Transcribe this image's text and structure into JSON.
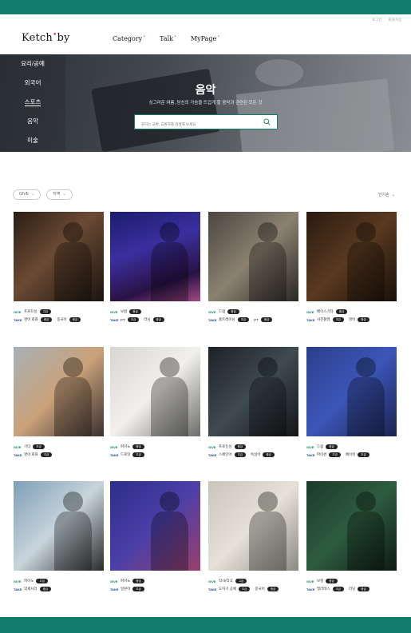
{
  "util": {
    "login": "로그인",
    "join": "회원가입"
  },
  "logo": {
    "text1": "Ketch",
    "dot": "•",
    "text2": "by"
  },
  "nav": [
    {
      "label": "Category",
      "mark": "•"
    },
    {
      "label": "Talk",
      "mark": "•"
    },
    {
      "label": "MyPage",
      "mark": "•"
    }
  ],
  "sidebar": {
    "items": [
      "요리/공예",
      "외국어",
      "스포츠",
      "음악",
      "미술"
    ],
    "active_index": 2
  },
  "hero": {
    "title": "음악",
    "subtitle": "싱그러운 여름, 당신의 가슴을 뜨겁게 할 음악과 관련된 모든 것",
    "search_placeholder": "원하는 교환, 교환자를 검색해 보세요"
  },
  "filters": [
    {
      "label": "GIVE",
      "chev": "⌄"
    },
    {
      "label": "지역",
      "chev": "⌄"
    }
  ],
  "sort": {
    "label": "인기순",
    "chev": "⌄"
  },
  "cards": [
    {
      "give": "프로듀싱",
      "give_lv": "고급",
      "take": [
        {
          "v": "영어 회화",
          "lv": "중급"
        },
        {
          "v": "중국어",
          "lv": "중급"
        }
      ]
    },
    {
      "give": "보컬",
      "give_lv": "중급",
      "take": [
        {
          "v": "PT",
          "lv": "초급"
        },
        {
          "v": "러닝",
          "lv": "중급"
        }
      ]
    },
    {
      "give": "드럼",
      "give_lv": "중급",
      "take": [
        {
          "v": "홈트레이닝",
          "lv": "초급"
        },
        {
          "v": "PT",
          "lv": "중급"
        }
      ]
    },
    {
      "give": "베이스기타",
      "give_lv": "중급",
      "take": [
        {
          "v": "사진촬영",
          "lv": "초급"
        },
        {
          "v": "영어",
          "lv": "중급"
        }
      ]
    },
    {
      "give": "기타",
      "give_lv": "초급",
      "take": [
        {
          "v": "영어 회화",
          "lv": "초급"
        }
      ]
    },
    {
      "give": "피아노",
      "give_lv": "중급",
      "take": [
        {
          "v": "드로잉",
          "lv": "초급"
        }
      ]
    },
    {
      "give": "프로듀싱",
      "give_lv": "중급",
      "take": [
        {
          "v": "스페인어",
          "lv": "초급"
        },
        {
          "v": "독일어",
          "lv": "중급"
        }
      ]
    },
    {
      "give": "드럼",
      "give_lv": "중급",
      "take": [
        {
          "v": "파이썬",
          "lv": "초급"
        },
        {
          "v": "베이킹",
          "lv": "초급"
        }
      ]
    },
    {
      "give": "피아노",
      "give_lv": "고급",
      "take": [
        {
          "v": "악세사리",
          "lv": "중급"
        }
      ]
    },
    {
      "give": "피아노",
      "give_lv": "중급",
      "take": [
        {
          "v": "일본어",
          "lv": "초급"
        }
      ]
    },
    {
      "give": "작사/작곡",
      "give_lv": "고급",
      "take": [
        {
          "v": "도자기 공예",
          "lv": "초급"
        },
        {
          "v": "중국어",
          "lv": "중급"
        }
      ]
    },
    {
      "give": "보컬",
      "give_lv": "중급",
      "take": [
        {
          "v": "필라테스",
          "lv": "초급"
        },
        {
          "v": "러닝",
          "lv": "중급"
        }
      ]
    }
  ],
  "labels": {
    "give": "GIVE",
    "take": "TAKE"
  },
  "colors": {
    "brand": "#0f7c6c",
    "accent": "#e0354a",
    "take": "#1b3f8a"
  }
}
